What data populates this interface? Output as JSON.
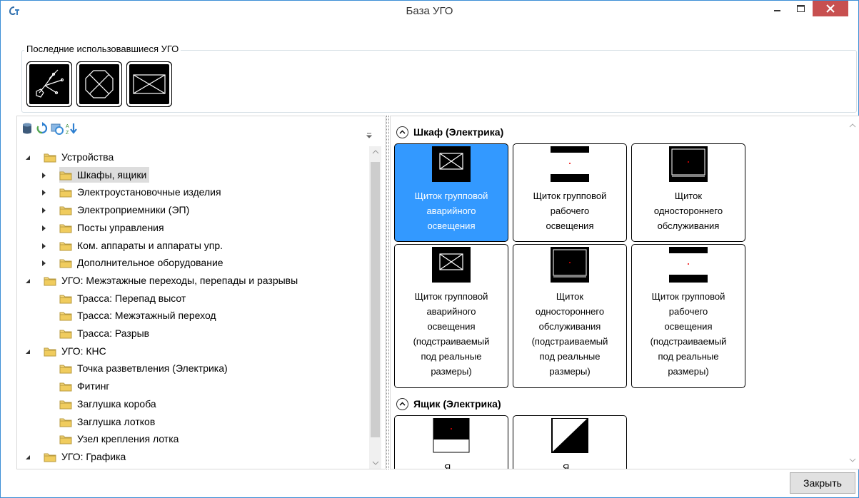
{
  "window": {
    "title": "База УГО"
  },
  "recent": {
    "legend": "Последние использовавшиеся УГО",
    "items": [
      {
        "icon": "wiring-symbol-icon"
      },
      {
        "icon": "octagon-cross-symbol-icon"
      },
      {
        "icon": "box-cross-symbol-icon"
      }
    ]
  },
  "toolbar": {
    "buttons": [
      "database-icon",
      "refresh-icon",
      "image-refresh-icon",
      "sort-icon"
    ]
  },
  "tree": {
    "items": [
      {
        "label": "Устройства",
        "level": 0,
        "expander": "expanded"
      },
      {
        "label": "Шкафы, ящики",
        "level": 1,
        "expander": "collapsed",
        "selected": true
      },
      {
        "label": "Электроустановочные изделия",
        "level": 1,
        "expander": "collapsed"
      },
      {
        "label": "Электроприемники (ЭП)",
        "level": 1,
        "expander": "collapsed"
      },
      {
        "label": "Посты управления",
        "level": 1,
        "expander": "collapsed"
      },
      {
        "label": "Ком. аппараты и аппараты упр.",
        "level": 1,
        "expander": "collapsed"
      },
      {
        "label": "Дополнительное оборудование",
        "level": 1,
        "expander": "collapsed"
      },
      {
        "label": "УГО: Межэтажные переходы, перепады и разрывы",
        "level": 0,
        "expander": "expanded"
      },
      {
        "label": "Трасса: Перепад высот",
        "level": 1,
        "expander": "none"
      },
      {
        "label": "Трасса: Межэтажный переход",
        "level": 1,
        "expander": "none"
      },
      {
        "label": "Трасса: Разрыв",
        "level": 1,
        "expander": "none"
      },
      {
        "label": "УГО: КНС",
        "level": 0,
        "expander": "expanded"
      },
      {
        "label": "Точка разветвления (Электрика)",
        "level": 1,
        "expander": "none"
      },
      {
        "label": "Фитинг",
        "level": 1,
        "expander": "none"
      },
      {
        "label": "Заглушка короба",
        "level": 1,
        "expander": "none"
      },
      {
        "label": "Заглушка лотков",
        "level": 1,
        "expander": "none"
      },
      {
        "label": "Узел крепления лотка",
        "level": 1,
        "expander": "none"
      },
      {
        "label": "УГО: Графика",
        "level": 0,
        "expander": "expanded"
      }
    ]
  },
  "groups": [
    {
      "title": "Шкаф (Электрика)",
      "tiles": [
        {
          "label": [
            "Щиток групповой",
            "аварийного",
            "освещения"
          ],
          "symbol": "box-cross-icon",
          "selected": true
        },
        {
          "label": [
            "Щиток групповой",
            "рабочего",
            "освещения"
          ],
          "symbol": "lighting-panel-icon"
        },
        {
          "label": [
            "Щиток",
            "одностороннего",
            "обслуживания"
          ],
          "symbol": "single-service-panel-icon"
        },
        {
          "label": [
            "Щиток групповой",
            "аварийного",
            "освещения",
            "(подстраиваемый",
            "под реальные",
            "размеры)"
          ],
          "symbol": "box-cross-icon"
        },
        {
          "label": [
            "Щиток",
            "одностороннего",
            "обслуживания",
            "(подстраиваемый",
            "под реальные",
            "размеры)"
          ],
          "symbol": "single-service-panel-icon"
        },
        {
          "label": [
            "Щиток групповой",
            "рабочего",
            "освещения",
            "(подстраиваемый",
            "под реальные",
            "размеры)"
          ],
          "symbol": "lighting-panel-icon"
        }
      ]
    },
    {
      "title": "Ящик (Электрика)",
      "tiles": [
        {
          "label": [
            "Я..."
          ],
          "symbol": "box-half-icon"
        },
        {
          "label": [
            "Я..."
          ],
          "symbol": "box-diagonal-icon"
        }
      ]
    }
  ],
  "footer": {
    "close_label": "Закрыть"
  },
  "colors": {
    "selection": "#3399ff",
    "close_button": "#c75050"
  }
}
